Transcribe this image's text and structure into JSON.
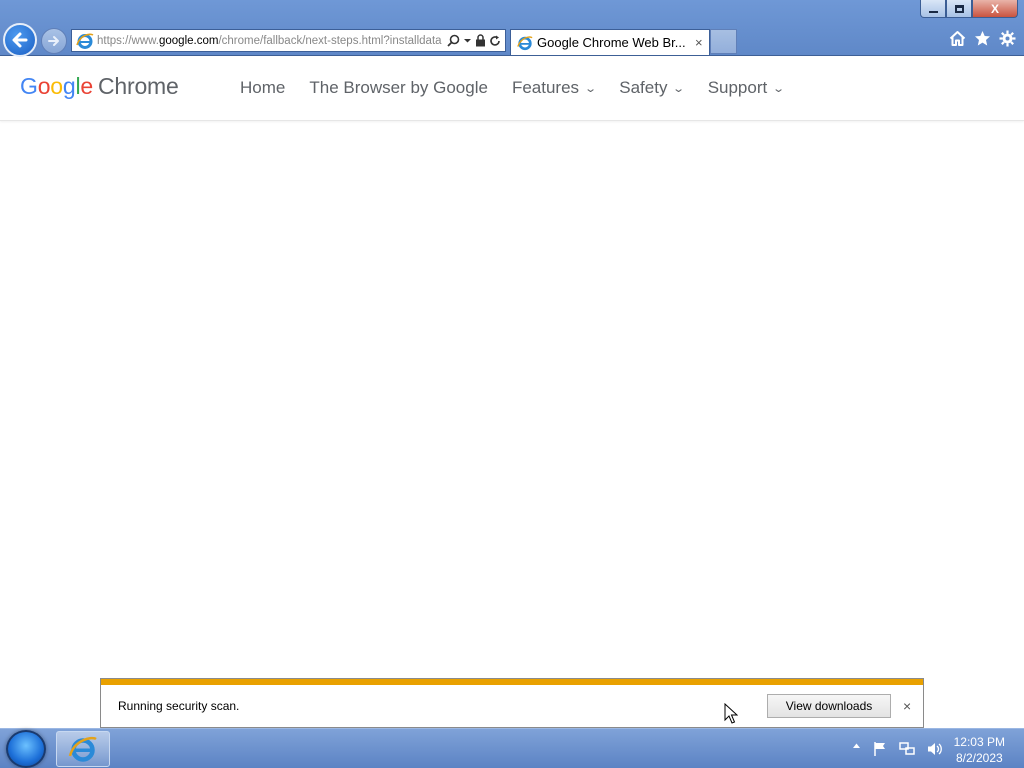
{
  "browser": {
    "address_url_prefix": "https://www.",
    "address_url_domain": "google.com",
    "address_url_path": "/chrome/fallback/next-steps.html?installdata",
    "tab_title": "Google Chrome Web Br...",
    "tab_close_glyph": "×",
    "window_close_glyph": "X"
  },
  "site": {
    "logo_google": [
      "G",
      "o",
      "o",
      "g",
      "l",
      "e"
    ],
    "logo_google_colors": [
      "#4285F4",
      "#EA4335",
      "#FBBC05",
      "#4285F4",
      "#34A853",
      "#EA4335"
    ],
    "logo_product": "Chrome",
    "nav": [
      {
        "label": "Home",
        "has_dropdown": false
      },
      {
        "label": "The Browser by Google",
        "has_dropdown": false
      },
      {
        "label": "Features",
        "has_dropdown": true
      },
      {
        "label": "Safety",
        "has_dropdown": true
      },
      {
        "label": "Support",
        "has_dropdown": true
      }
    ],
    "chevron_glyph": "⌄"
  },
  "notification": {
    "message": "Running security scan.",
    "button_label": "View downloads",
    "close_glyph": "×",
    "progress_color": "#e9a100"
  },
  "taskbar": {
    "time": "12:03 PM",
    "date": "8/2/2023"
  },
  "icons": {
    "back": "back-arrow-icon",
    "forward": "forward-arrow-icon",
    "home": "home-icon",
    "favorites": "star-icon",
    "tools": "gear-icon"
  }
}
